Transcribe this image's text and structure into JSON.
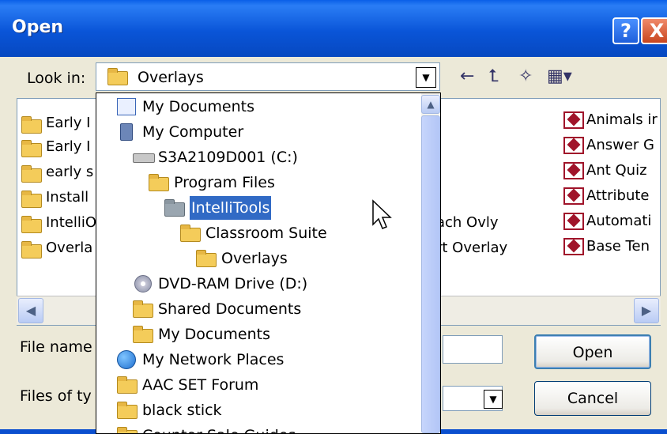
{
  "window": {
    "title": "Open",
    "help_label": "?",
    "close_label": "X"
  },
  "look_in": {
    "label": "Look in:",
    "value": "Overlays"
  },
  "file_list": {
    "left_items": [
      "Early I",
      "Early I",
      "early s",
      "Install",
      "IntelliO",
      "Overla"
    ],
    "middle_items": [
      "ach Ovly",
      "rt Overlay"
    ],
    "right_items": [
      "Animals ir",
      "Answer G",
      "Ant Quiz",
      "Attribute",
      "Automati",
      "Base Ten"
    ]
  },
  "dropdown": {
    "items": [
      {
        "label": "My Documents",
        "icon": "my-documents-icon"
      },
      {
        "label": "My Computer",
        "icon": "computer-icon"
      },
      {
        "label": "S3A2109D001 (C:)",
        "icon": "hard-drive-icon"
      },
      {
        "label": "Program Files",
        "icon": "folder-icon"
      },
      {
        "label": "IntelliTools",
        "icon": "folder-icon",
        "selected": true
      },
      {
        "label": "Classroom Suite",
        "icon": "folder-icon"
      },
      {
        "label": "Overlays",
        "icon": "folder-icon"
      },
      {
        "label": "DVD-RAM Drive (D:)",
        "icon": "dvd-drive-icon"
      },
      {
        "label": "Shared Documents",
        "icon": "folder-icon"
      },
      {
        "label": "My Documents",
        "icon": "folder-icon"
      },
      {
        "label": "My Network Places",
        "icon": "network-icon"
      },
      {
        "label": "AAC SET Forum",
        "icon": "folder-icon"
      },
      {
        "label": "black stick",
        "icon": "folder-icon"
      },
      {
        "label": "Counter Sale Guides",
        "icon": "folder-icon"
      }
    ]
  },
  "file_name": {
    "label": "File name",
    "value": ""
  },
  "files_of_type": {
    "label": "Files of ty",
    "value": ""
  },
  "buttons": {
    "open": "Open",
    "cancel": "Cancel"
  },
  "colors": {
    "title_bar": "#0A55D8",
    "selection": "#316AC5",
    "dialog_bg": "#ECE9D8"
  }
}
